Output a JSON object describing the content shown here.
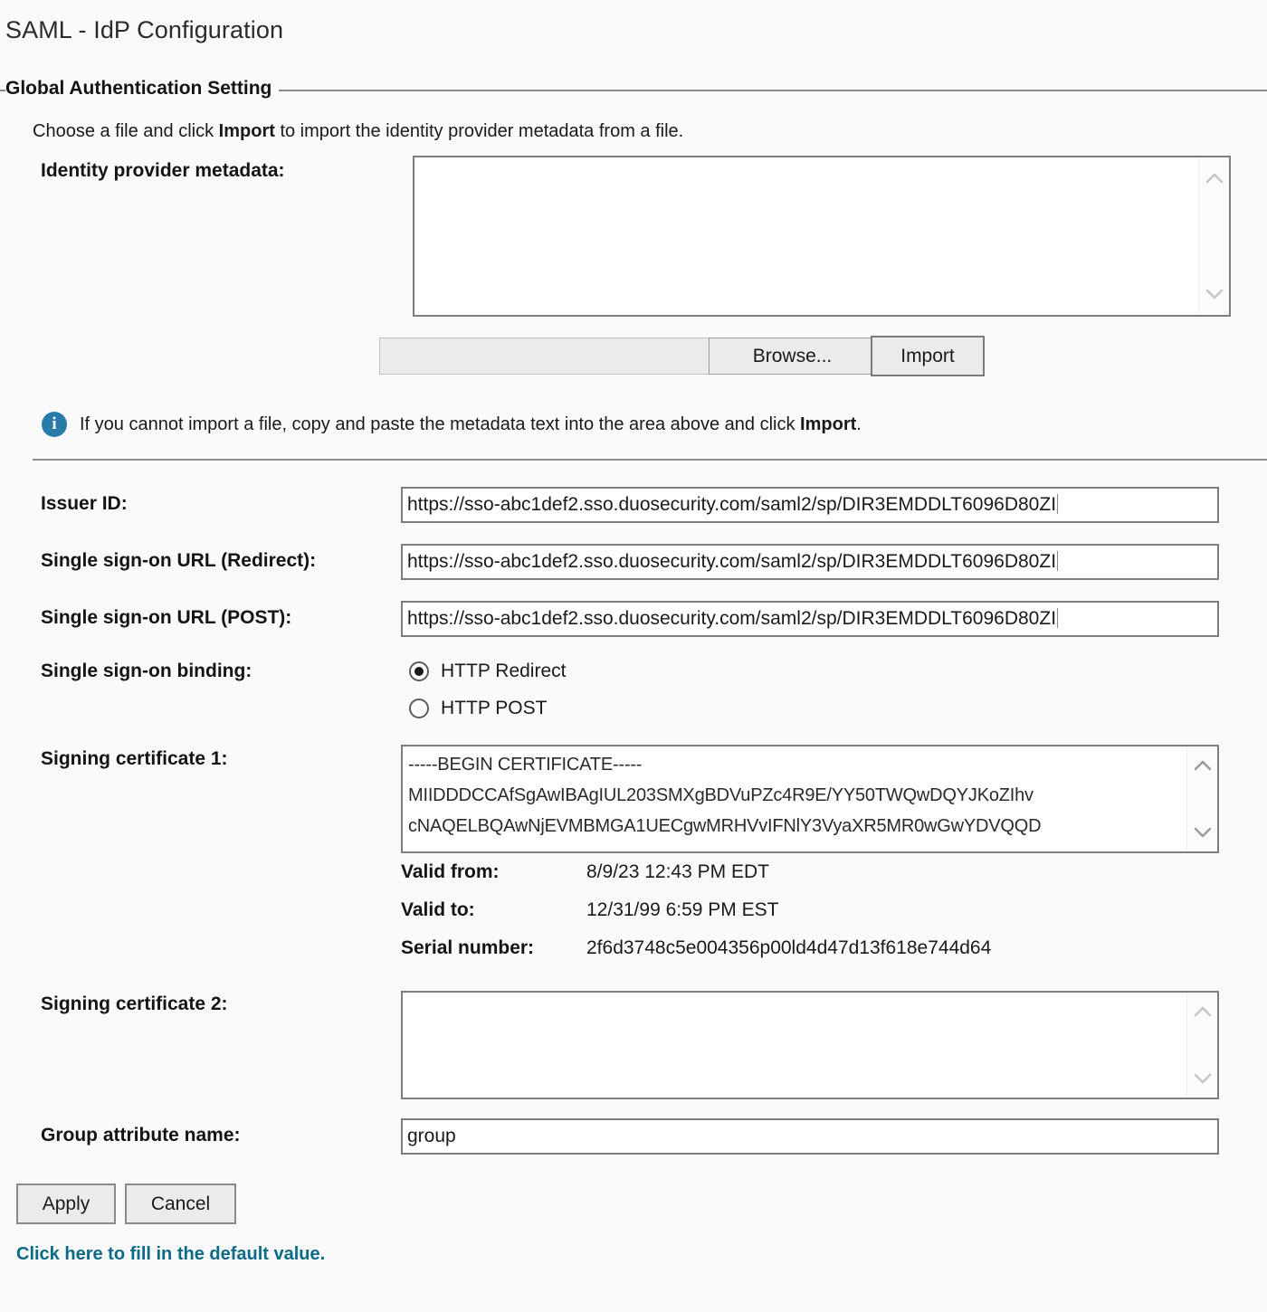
{
  "page": {
    "title": "SAML - IdP Configuration"
  },
  "fieldset": {
    "legend": "Global Authentication Setting",
    "intro_before": "Choose a file and click ",
    "intro_bold": "Import",
    "intro_after": " to import the identity provider metadata from a file."
  },
  "metadata": {
    "label": "Identity provider metadata:",
    "value": "",
    "placeholder": "",
    "scroll_up_icon": "chevron-up-icon",
    "scroll_down_icon": "chevron-down-icon"
  },
  "file_picker": {
    "file_value": "",
    "browse_label": "Browse...",
    "import_label": "Import"
  },
  "info_note": {
    "icon": "info-icon",
    "icon_glyph": "i",
    "text_before": "If you cannot import a file, copy and paste the metadata text into the area above and click ",
    "text_bold": "Import",
    "text_after": "."
  },
  "fields": {
    "issuer_id": {
      "label": "Issuer ID:",
      "value": "https://sso-abc1def2.sso.duosecurity.com/saml2/sp/DIR3EMDDLT6096D80ZI"
    },
    "sso_url_redirect": {
      "label": "Single sign-on URL (Redirect):",
      "value": "https://sso-abc1def2.sso.duosecurity.com/saml2/sp/DIR3EMDDLT6096D80ZI"
    },
    "sso_url_post": {
      "label": "Single sign-on URL (POST):",
      "value": "https://sso-abc1def2.sso.duosecurity.com/saml2/sp/DIR3EMDDLT6096D80ZI"
    },
    "sso_binding": {
      "label": "Single sign-on binding:",
      "options": [
        {
          "label": "HTTP Redirect",
          "selected": true
        },
        {
          "label": "HTTP POST",
          "selected": false
        }
      ]
    },
    "signing_cert_1": {
      "label": "Signing certificate 1:",
      "lines": [
        "-----BEGIN CERTIFICATE-----",
        "MIIDDDCCAfSgAwIBAgIUL203SMXgBDVuPZc4R9E/YY50TWQwDQYJKoZIhv",
        "cNAQELBQAwNjEVMBMGA1UECgwMRHVvIFNlY3VyaXR5MR0wGwYDVQQD"
      ]
    },
    "cert_details": [
      {
        "key": "Valid from:",
        "value": "8/9/23 12:43 PM EDT"
      },
      {
        "key": "Valid to:",
        "value": "12/31/99 6:59 PM EST"
      },
      {
        "key": "Serial number:",
        "value": "2f6d3748c5e004356p00ld4d47d13f618e744d64"
      }
    ],
    "signing_cert_2": {
      "label": "Signing certificate 2:",
      "value": ""
    },
    "group_attribute": {
      "label": "Group attribute name:",
      "value": "group"
    }
  },
  "actions": {
    "apply_label": "Apply",
    "cancel_label": "Cancel",
    "default_link_label": "Click here to fill in the default value."
  },
  "colors": {
    "link": "#0b6a86",
    "info_badge": "#2a7ca8",
    "border": "#7d7d7d",
    "button_face": "#ebebeb",
    "page_bg": "#fafafa"
  }
}
